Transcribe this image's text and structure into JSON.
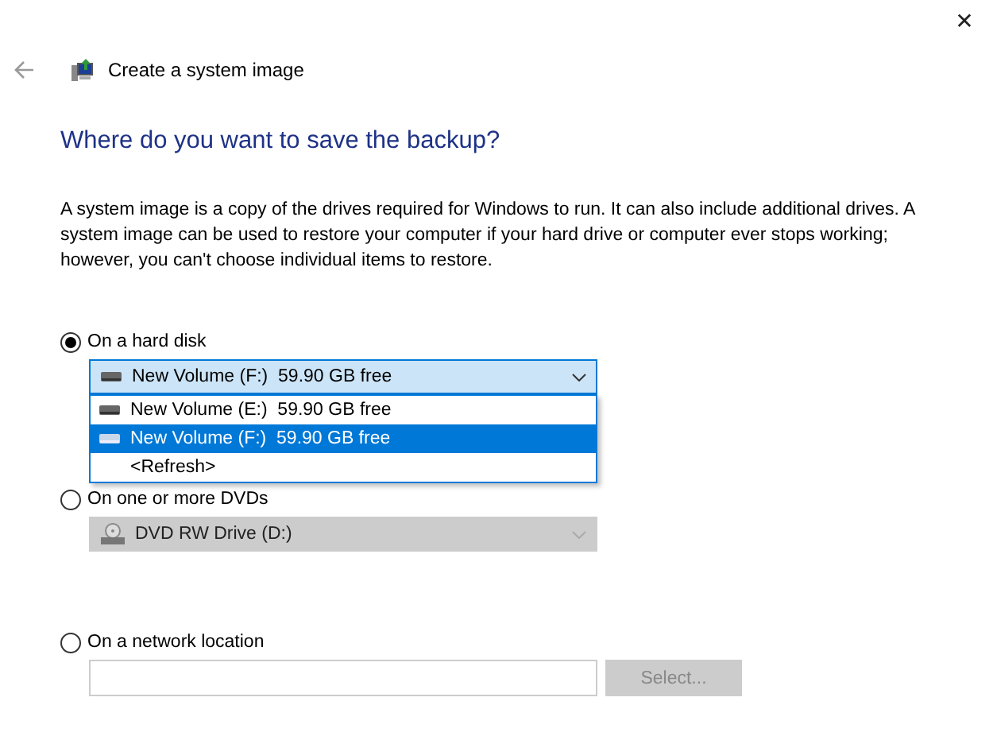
{
  "window": {
    "close": "✕"
  },
  "header": {
    "title": "Create a system image"
  },
  "heading": "Where do you want to save the backup?",
  "description": "A system image is a copy of the drives required for Windows to run. It can also include additional drives. A system image can be used to restore your computer if your hard drive or computer ever stops working; however, you can't choose individual items to restore.",
  "options": [
    {
      "kind": "combo",
      "label": "On a hard disk",
      "selected": true,
      "combo": {
        "value": "New Volume (F:)  59.90 GB free",
        "kind": "drive",
        "disabled": false,
        "expanded": true,
        "items": [
          {
            "kind": "drive",
            "label": "New Volume (E:)  59.90 GB free",
            "selected": false
          },
          {
            "kind": "drive",
            "label": "New Volume (F:)  59.90 GB free",
            "selected": true
          },
          {
            "kind": "refresh",
            "label": "<Refresh>",
            "selected": false
          }
        ]
      }
    },
    {
      "kind": "combo",
      "label": "On one or more DVDs",
      "selected": false,
      "combo": {
        "value": "DVD RW Drive (D:)",
        "kind": "dvd",
        "disabled": true,
        "expanded": false
      }
    },
    {
      "kind": "network",
      "label": "On a network location",
      "selected": false,
      "field": {
        "disabled": true
      },
      "button": {
        "label": "Select...",
        "disabled": true
      }
    }
  ]
}
